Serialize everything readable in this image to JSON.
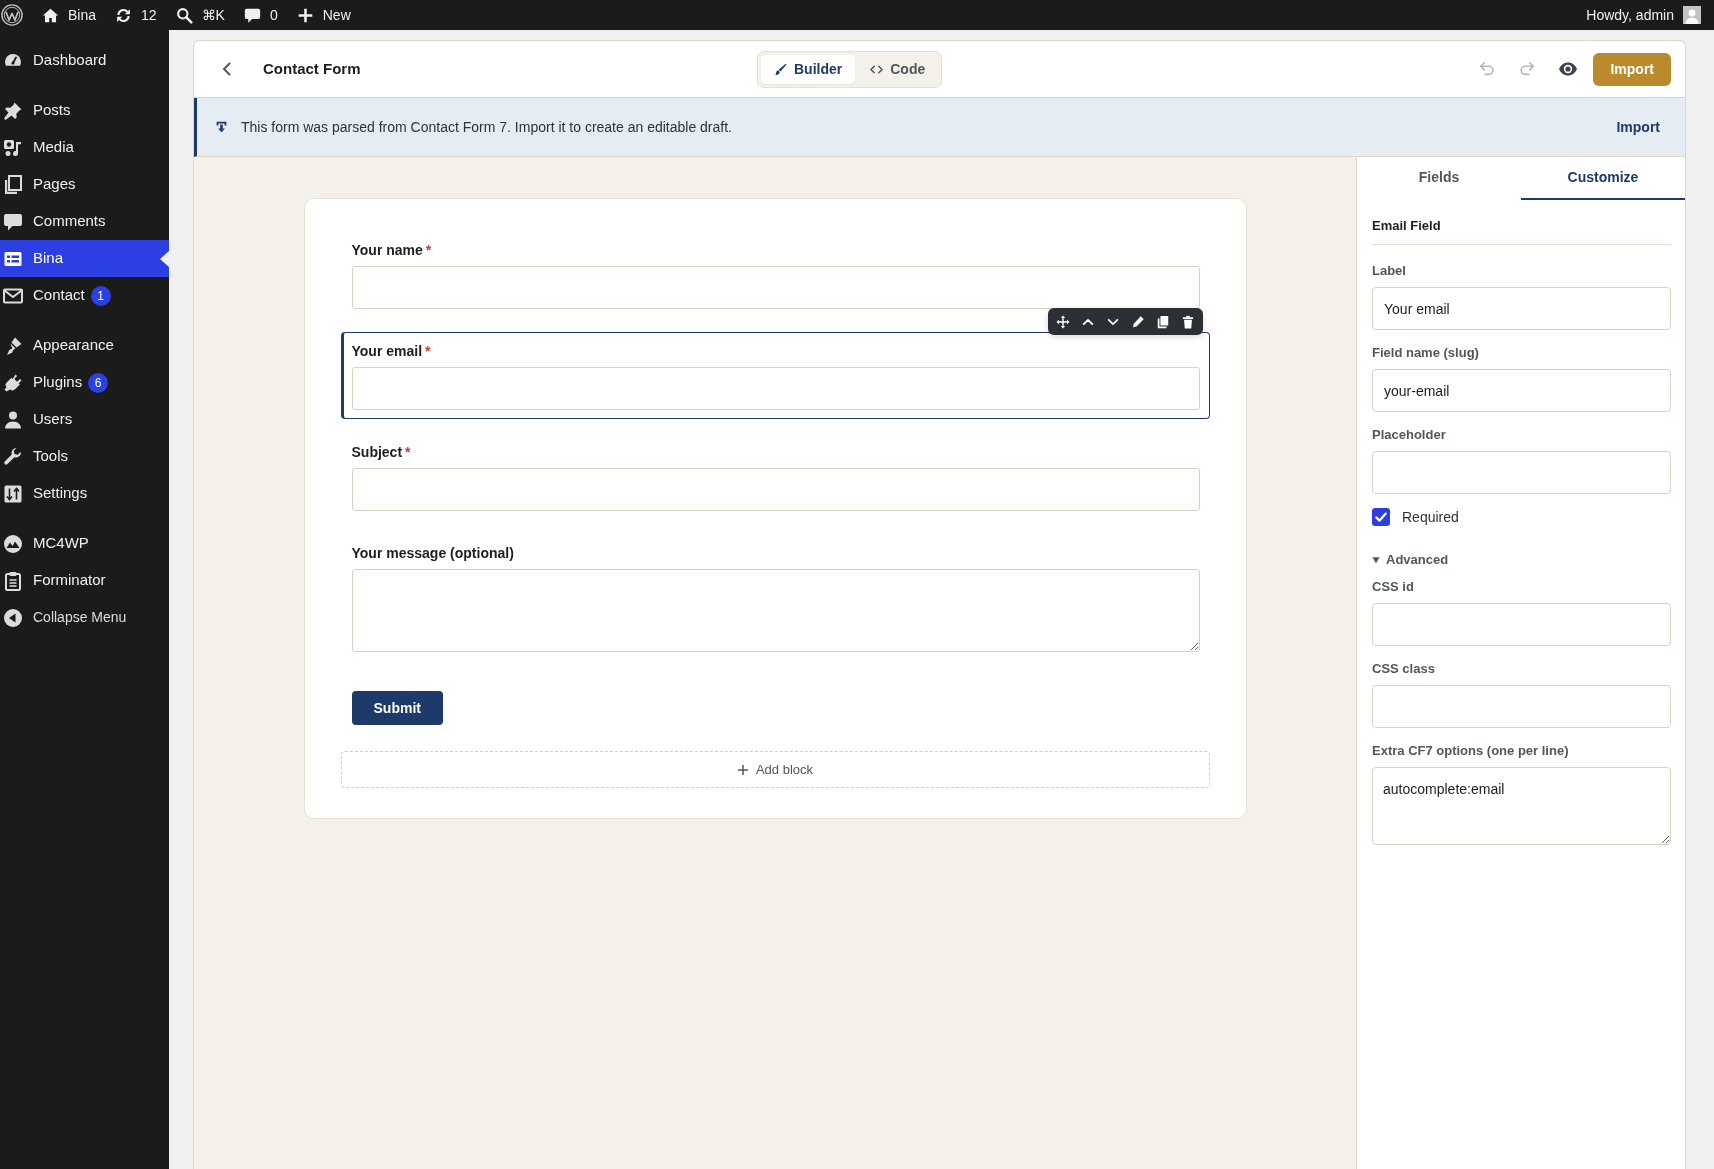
{
  "admin_bar": {
    "site": "Bina",
    "updates": "12",
    "search_shortcut": "⌘K",
    "comments": "0",
    "new": "New",
    "greeting": "Howdy, admin"
  },
  "sidebar": {
    "groups": [
      {
        "items": [
          {
            "label": "Dashboard",
            "selected": false
          }
        ]
      },
      {
        "items": [
          {
            "label": "Posts",
            "selected": false
          },
          {
            "label": "Media",
            "selected": false
          },
          {
            "label": "Pages",
            "selected": false
          },
          {
            "label": "Comments",
            "selected": false
          },
          {
            "label": "Bina",
            "selected": true
          },
          {
            "label": "Contact",
            "badge": "1",
            "selected": false
          }
        ]
      },
      {
        "items": [
          {
            "label": "Appearance",
            "selected": false
          },
          {
            "label": "Plugins",
            "badge": "6",
            "selected": false
          },
          {
            "label": "Users",
            "selected": false
          },
          {
            "label": "Tools",
            "selected": false
          },
          {
            "label": "Settings",
            "selected": false
          }
        ]
      },
      {
        "items": [
          {
            "label": "MC4WP",
            "selected": false
          },
          {
            "label": "Forminator",
            "selected": false
          }
        ]
      }
    ],
    "collapse": "Collapse Menu"
  },
  "header": {
    "title": "Contact Form",
    "modes": [
      {
        "label": "Builder",
        "selected": true
      },
      {
        "label": "Code",
        "selected": false
      }
    ],
    "undo": {
      "disabled": true
    },
    "redo": {
      "disabled": true
    },
    "import_button": "Import"
  },
  "notice": {
    "text": "This form was parsed from Contact Form 7. Import it to create an editable draft.",
    "action": "Import"
  },
  "form": {
    "fields": [
      {
        "kind": "input",
        "label": "Your name",
        "required_mark": "*",
        "selected": false
      },
      {
        "kind": "input",
        "label": "Your email",
        "required_mark": "*",
        "selected": true
      },
      {
        "kind": "input",
        "label": "Subject",
        "required_mark": "*",
        "selected": false
      },
      {
        "kind": "textarea",
        "label": "Your message (optional)",
        "selected": false
      }
    ],
    "submit": "Submit",
    "add_block": "Add block"
  },
  "panel": {
    "tabs": [
      {
        "label": "Fields",
        "selected": false
      },
      {
        "label": "Customize",
        "selected": true
      }
    ],
    "heading": "Email Field",
    "settings": [
      {
        "kind": "input",
        "label": "Label",
        "value": "Your email"
      },
      {
        "kind": "input",
        "label": "Field name (slug)",
        "value": "your-email"
      },
      {
        "kind": "input",
        "label": "Placeholder"
      },
      {
        "kind": "checkbox",
        "label": "Required",
        "checked": true
      },
      {
        "kind": "section",
        "label": "Advanced",
        "expanded": true
      },
      {
        "kind": "input",
        "label": "CSS id"
      },
      {
        "kind": "input",
        "label": "CSS class"
      },
      {
        "kind": "textarea",
        "label": "Extra CF7 options (one per line)",
        "value": "autocomplete:email"
      }
    ]
  }
}
